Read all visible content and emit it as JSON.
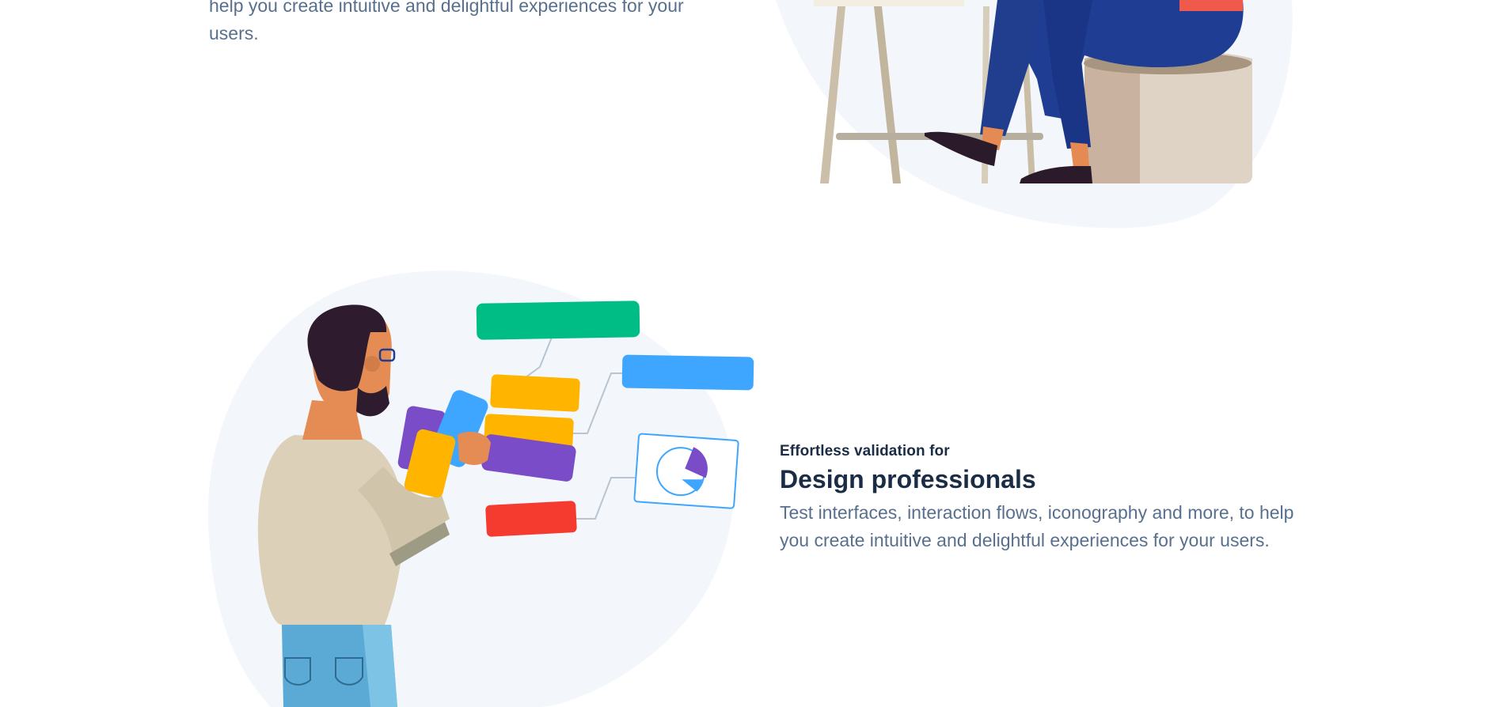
{
  "top_section": {
    "description": "help you create intuitive and delightful experiences for your users."
  },
  "bottom_section": {
    "kicker": "Effortless validation for",
    "heading": "Design professionals",
    "description": "Test interfaces, interaction flows, iconography and more, to help you create intuitive and delightful experiences for your users."
  },
  "colors": {
    "heading": "#1b2d45",
    "body_text": "#58708d",
    "blob": "#f3f7fc",
    "green": "#00bd85",
    "yellow": "#ffb400",
    "blue": "#3ea6ff",
    "purple": "#7a4cc7",
    "red": "#f53b30"
  },
  "icons": [
    "person-sitting-illustration",
    "designer-flowchart-illustration",
    "pie-chart-icon"
  ]
}
